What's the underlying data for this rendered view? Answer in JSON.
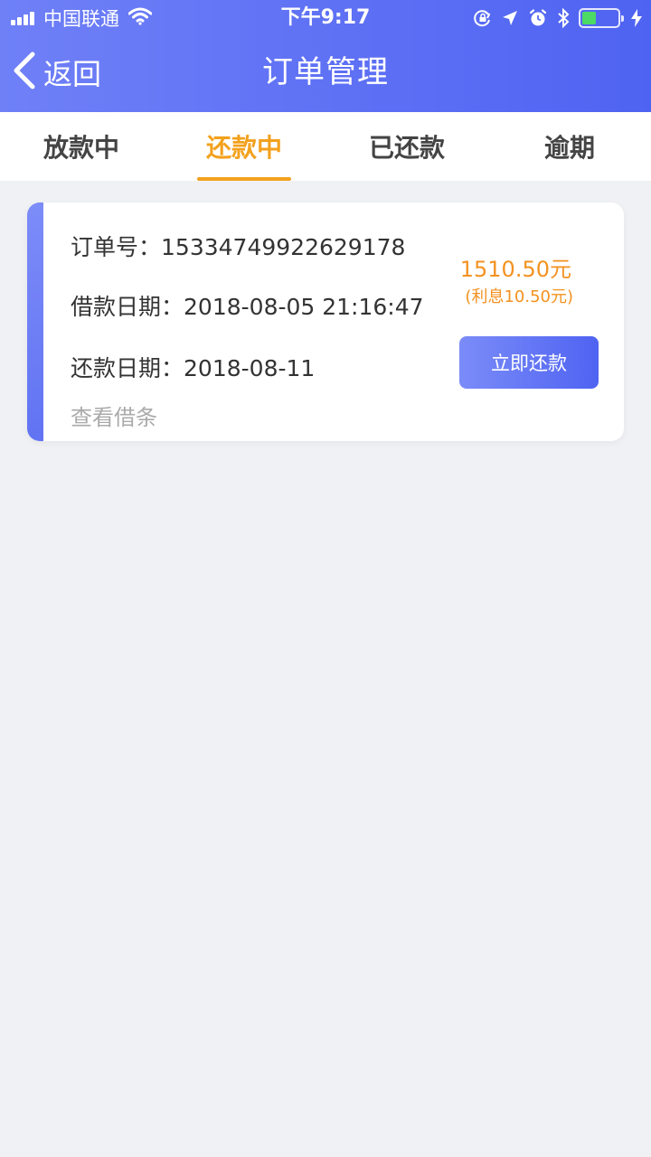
{
  "status_bar": {
    "carrier": "中国联通",
    "time": "下午9:17",
    "battery_level": 0.4
  },
  "nav": {
    "back_label": "返回",
    "title": "订单管理"
  },
  "tabs": [
    {
      "label": "放款中",
      "active": false
    },
    {
      "label": "还款中",
      "active": true
    },
    {
      "label": "已还款",
      "active": false
    },
    {
      "label": "逾期",
      "active": false
    }
  ],
  "order": {
    "order_no_label": "订单号：",
    "order_no": "15334749922629178",
    "borrow_date_label": "借款日期：",
    "borrow_date": "2018-08-05 21:16:47",
    "repay_date_label": "还款日期：",
    "repay_date": "2018-08-11",
    "amount": "1510.50元",
    "interest": "(利息10.50元)",
    "repay_button": "立即还款",
    "view_note": "查看借条"
  },
  "colors": {
    "header_start": "#6f80f7",
    "header_end": "#4f63f2",
    "active_tab": "#f3a11d",
    "amount": "#f39220",
    "background": "#f0f1f4"
  }
}
